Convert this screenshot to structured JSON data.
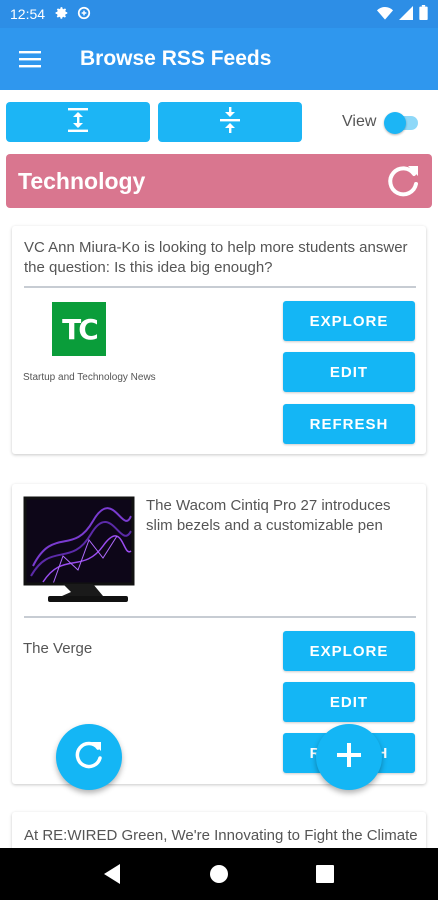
{
  "status_bar": {
    "time": "12:54",
    "icons_left": [
      "settings-icon",
      "data-saver-icon"
    ],
    "icons_right": [
      "wifi-icon",
      "signal-icon",
      "battery-icon"
    ]
  },
  "app_bar": {
    "title": "Browse RSS Feeds",
    "color": "#2f97ee"
  },
  "toolbar": {
    "expand_icon": "expand-vertical-icon",
    "collapse_icon": "collapse-vertical-icon",
    "view_label": "View",
    "view_toggle_on": true,
    "accent": "#1cb5f5"
  },
  "category": {
    "title": "Technology",
    "color": "#d9768f"
  },
  "feeds": [
    {
      "headline": "VC Ann Miura-Ko is looking to help more students answer the question: Is this idea big enough?",
      "logo_text": "TC",
      "source_caption": "Startup and Technology News",
      "buttons": {
        "explore": "EXPLORE",
        "edit": "EDIT",
        "refresh": "REFRESH"
      }
    },
    {
      "headline": "The Wacom Cintiq Pro 27 introduces slim bezels and a customizable pen",
      "source_name": "The Verge",
      "buttons": {
        "explore": "EXPLORE",
        "edit": "EDIT",
        "refresh": "REFRESH"
      }
    },
    {
      "headline": "At RE:WIRED Green, We're Innovating to Fight the Climate"
    }
  ],
  "fabs": [
    "refresh-icon",
    "add-icon"
  ],
  "nav": [
    "back-icon",
    "home-icon",
    "recents-icon"
  ]
}
